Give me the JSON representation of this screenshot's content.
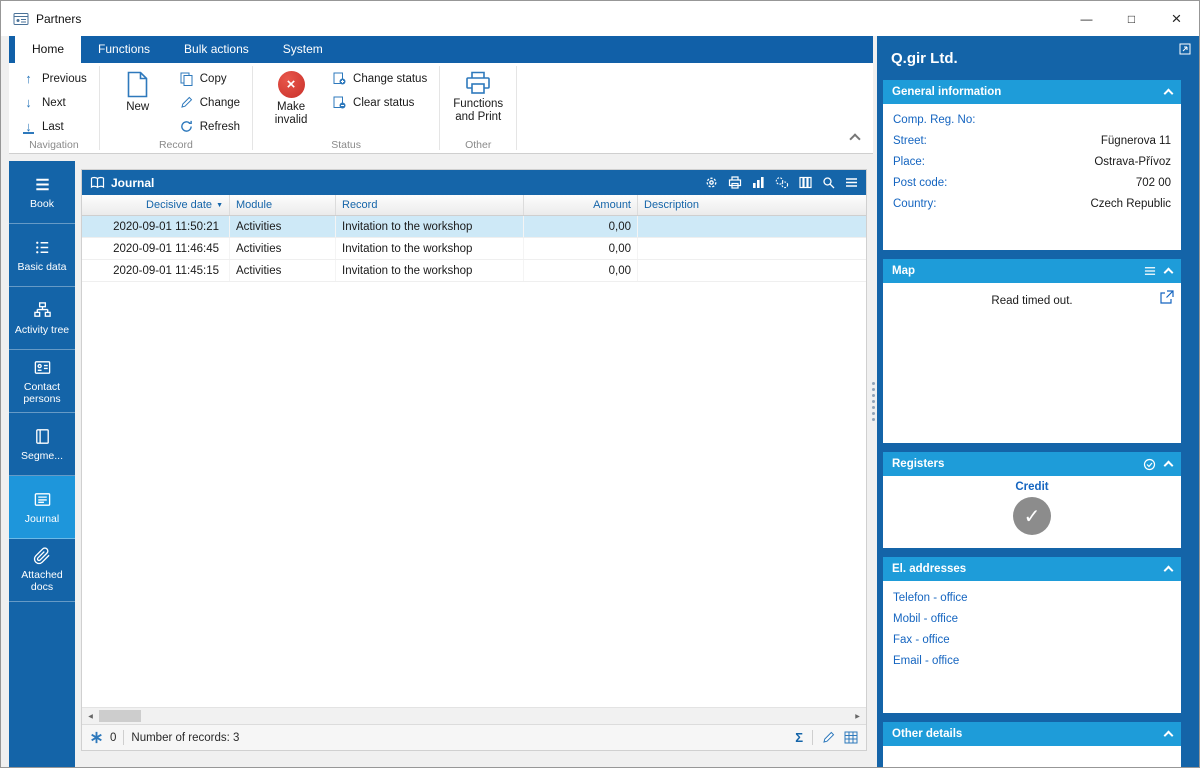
{
  "window": {
    "title": "Partners",
    "controls": {
      "minimize": "—",
      "maximize": "□",
      "close": "×"
    }
  },
  "glyphs": {
    "up_arrow": "↑",
    "down_arrow": "↓",
    "sort_desc": "▼",
    "sigma": "Σ",
    "check": "✓",
    "x_mark": "×",
    "scroll_left": "◀",
    "scroll_right": "▶"
  },
  "ribbon": {
    "tabs": [
      {
        "label": "Home",
        "active": true
      },
      {
        "label": "Functions",
        "active": false
      },
      {
        "label": "Bulk actions",
        "active": false
      },
      {
        "label": "System",
        "active": false
      }
    ],
    "groups": {
      "navigation": {
        "label": "Navigation",
        "previous": "Previous",
        "next": "Next",
        "last": "Last"
      },
      "record": {
        "label": "Record",
        "new": "New",
        "copy": "Copy",
        "change": "Change",
        "refresh": "Refresh"
      },
      "status": {
        "label": "Status",
        "make_invalid": "Make invalid",
        "change_status": "Change status",
        "clear_status": "Clear status"
      },
      "other": {
        "label": "Other",
        "functions_and_print": "Functions and Print"
      }
    }
  },
  "sidebar": {
    "items": [
      {
        "label": "Book",
        "active": false
      },
      {
        "label": "Basic data",
        "active": false
      },
      {
        "label": "Activity tree",
        "active": false
      },
      {
        "label": "Contact persons",
        "active": false
      },
      {
        "label": "Segme...",
        "active": false
      },
      {
        "label": "Journal",
        "active": true
      },
      {
        "label": "Attached docs",
        "active": false
      }
    ]
  },
  "journal": {
    "title": "Journal",
    "columns": {
      "date": "Decisive date",
      "module": "Module",
      "record": "Record",
      "amount": "Amount",
      "description": "Description"
    },
    "rows": [
      {
        "date": "2020-09-01 11:50:21",
        "module": "Activities",
        "record": "Invitation to the workshop",
        "amount": "0,00",
        "description": "",
        "selected": true
      },
      {
        "date": "2020-09-01 11:46:45",
        "module": "Activities",
        "record": "Invitation to the workshop",
        "amount": "0,00",
        "description": "",
        "selected": false
      },
      {
        "date": "2020-09-01 11:45:15",
        "module": "Activities",
        "record": "Invitation to the workshop",
        "amount": "0,00",
        "description": "",
        "selected": false
      }
    ],
    "statusbar": {
      "counter": "0",
      "records": "Number of records: 3"
    }
  },
  "detail": {
    "company_name": "Q.gir Ltd.",
    "general": {
      "title": "General information",
      "rows": [
        {
          "label": "Comp. Reg. No:",
          "value": ""
        },
        {
          "label": "Street:",
          "value": "Fügnerova 11"
        },
        {
          "label": "Place:",
          "value": "Ostrava-Přívoz"
        },
        {
          "label": "Post code:",
          "value": "702 00"
        },
        {
          "label": "Country:",
          "value": "Czech Republic"
        }
      ]
    },
    "map": {
      "title": "Map",
      "message": "Read timed out."
    },
    "registers": {
      "title": "Registers",
      "credit_label": "Credit"
    },
    "addresses": {
      "title": "El. addresses",
      "items": [
        "Telefon - office",
        "Mobil - office",
        "Fax - office",
        "Email - office"
      ]
    },
    "other": {
      "title": "Other details"
    }
  },
  "colors": {
    "accent_blue": "#1464A8",
    "tab_strip_blue": "#1160A8",
    "header_blue": "#1565A9",
    "active_item_blue": "#1E96DB",
    "section_header_cyan": "#1E9CD9",
    "selected_row": "#CEE9F7",
    "invalid_red": "#DA3B2F",
    "icon_blue": "#2E79BC",
    "link_blue": "#1565C0"
  }
}
